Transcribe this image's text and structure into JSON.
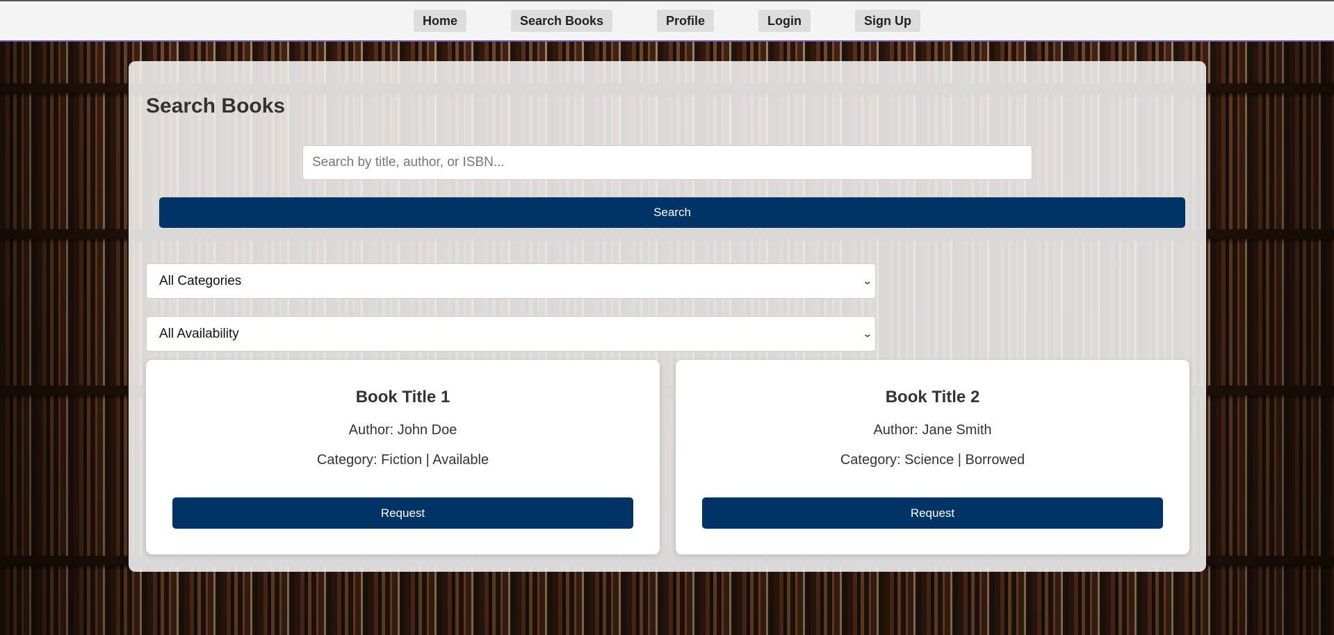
{
  "nav": {
    "items": [
      {
        "label": "Home"
      },
      {
        "label": "Search Books"
      },
      {
        "label": "Profile"
      },
      {
        "label": "Login"
      },
      {
        "label": "Sign Up"
      }
    ]
  },
  "main": {
    "title": "Search Books",
    "search": {
      "placeholder": "Search by title, author, or ISBN...",
      "value": "",
      "button_label": "Search"
    },
    "filters": {
      "category": {
        "selected": "All Categories"
      },
      "availability": {
        "selected": "All Availability"
      }
    },
    "books": [
      {
        "title": "Book Title 1",
        "author": "Author: John Doe",
        "meta": "Category: Fiction | Available",
        "button_label": "Request"
      },
      {
        "title": "Book Title 2",
        "author": "Author: Jane Smith",
        "meta": "Category: Science | Borrowed",
        "button_label": "Request"
      }
    ]
  },
  "colors": {
    "primary": "#003366",
    "nav_bg": "#f4f4f4",
    "nav_border": "#6a5acd"
  }
}
